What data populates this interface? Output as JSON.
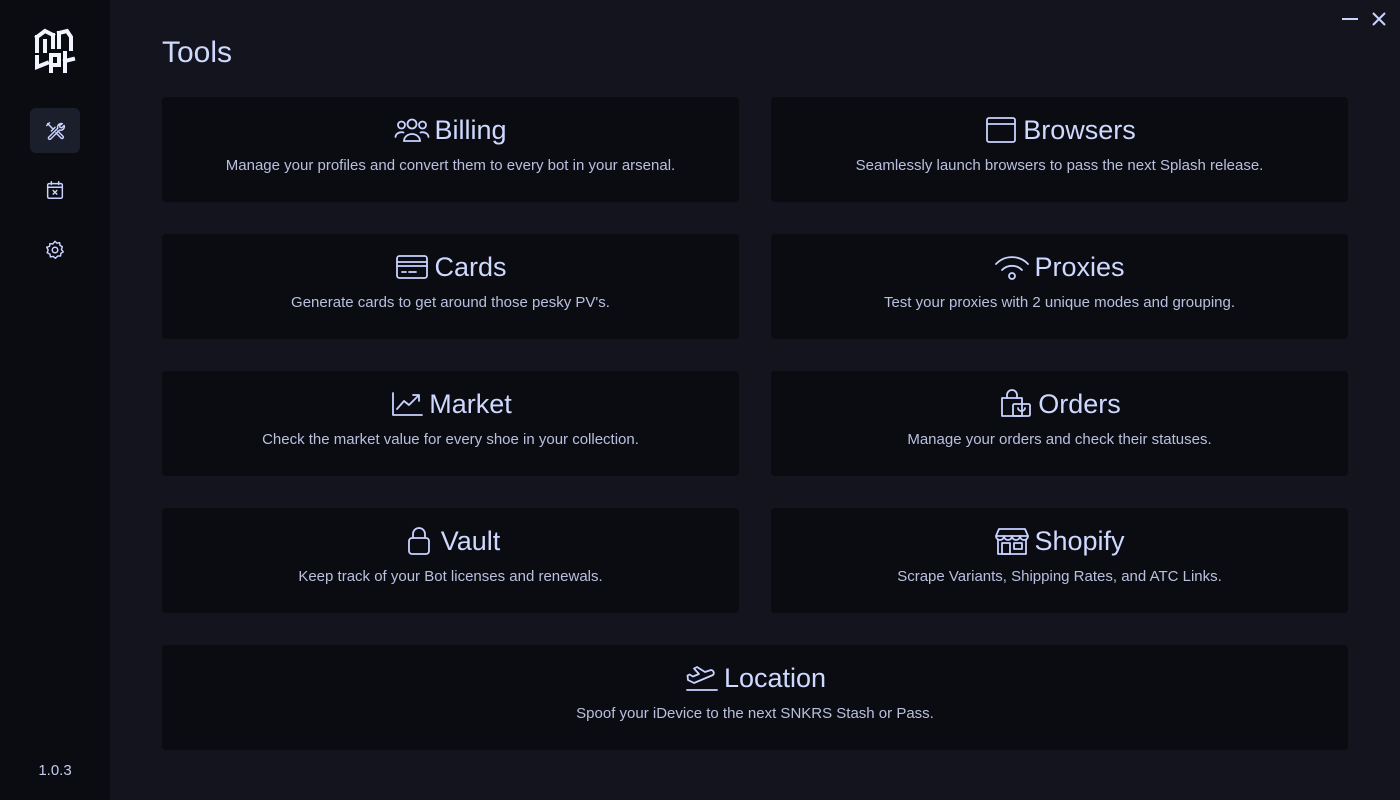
{
  "app": {
    "version": "1.0.3",
    "window_controls": {
      "minimize_icon": "minus-icon",
      "close_icon": "x-icon"
    }
  },
  "sidebar": {
    "items": [
      {
        "name": "tools",
        "icon": "tools-icon",
        "active": true
      },
      {
        "name": "calendar",
        "icon": "calendar-x-icon",
        "active": false
      },
      {
        "name": "settings",
        "icon": "gear-icon",
        "active": false
      }
    ]
  },
  "page": {
    "title": "Tools"
  },
  "tools": [
    {
      "title": "Billing",
      "icon": "users-icon",
      "description": "Manage your profiles and convert them to every bot in your arsenal."
    },
    {
      "title": "Browsers",
      "icon": "browser-window-icon",
      "description": "Seamlessly launch browsers to pass the next Splash release."
    },
    {
      "title": "Cards",
      "icon": "credit-card-icon",
      "description": "Generate cards to get around those pesky PV's."
    },
    {
      "title": "Proxies",
      "icon": "wifi-icon",
      "description": "Test your proxies with 2 unique modes and grouping."
    },
    {
      "title": "Market",
      "icon": "trending-up-icon",
      "description": "Check the market value for every shoe in your collection."
    },
    {
      "title": "Orders",
      "icon": "shopping-bag-icon",
      "description": "Manage your orders and check their statuses."
    },
    {
      "title": "Vault",
      "icon": "lock-icon",
      "description": "Keep track of your Bot licenses and renewals."
    },
    {
      "title": "Shopify",
      "icon": "storefront-icon",
      "description": "Scrape Variants, Shipping Rates, and ATC Links."
    },
    {
      "title": "Location",
      "icon": "plane-takeoff-icon",
      "description": "Spoof your iDevice to the next SNKRS Stash or Pass."
    }
  ],
  "colors": {
    "accent": "#cfd9ff",
    "background": "#13141d",
    "panel": "#0b0c12"
  }
}
